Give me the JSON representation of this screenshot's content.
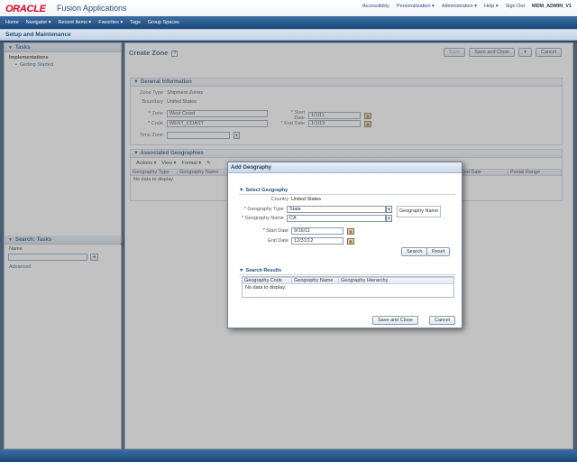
{
  "header": {
    "logo_text": "ORACLE",
    "app_name": "Fusion Applications",
    "links": [
      "Accessibility",
      "Personalization ▾",
      "Administration ▾",
      "Help ▾",
      "Sign Out"
    ],
    "user": "MDM_ADMIN_V1"
  },
  "navbar": {
    "items": [
      "Home",
      "Navigator ▾",
      "Recent Items ▾",
      "Favorites ▾",
      "Tags",
      "Group Spaces"
    ]
  },
  "titlebar": {
    "title": "Setup and Maintenance"
  },
  "tasks_panel": {
    "title": "Tasks",
    "section": "Implementations",
    "link": "Getting Started"
  },
  "search_tasks": {
    "title": "Search: Tasks",
    "name_label": "Name",
    "go_icon": "arrow-right-icon",
    "advanced": "Advanced"
  },
  "main": {
    "title": "Create Zone",
    "help_icon": "?",
    "buttons": {
      "save": "Save",
      "save_close": "Save and Close",
      "dropdown": "▾",
      "cancel": "Cancel"
    },
    "general": {
      "title": "General Information",
      "zone_type_label": "Zone Type",
      "zone_type_value": "Shipment Zones",
      "boundary_label": "Boundary",
      "boundary_value": "United States",
      "zone_label": "Zone",
      "zone_value": "West Coast",
      "code_label": "Code",
      "code_value": "WEST_COAST",
      "start_label": "Start Date",
      "start_value": "1/1/11",
      "end_label": "End Date",
      "end_value": "1/1/19",
      "tz_label": "Time Zone",
      "tz_value": ""
    },
    "assoc": {
      "title": "Associated Geographies",
      "toolbar": [
        "Actions ▾",
        "View ▾",
        "Format ▾"
      ],
      "columns": [
        "Geography Type",
        "Geography Name",
        "",
        "",
        "",
        "End Date",
        "Postal Range"
      ],
      "no_data": "No data to display."
    }
  },
  "dialog": {
    "title": "Add Geography",
    "select_section": "Select Geography",
    "country_label": "Country",
    "country_value": "United States",
    "geo_type_label": "Geography Type",
    "geo_type_value": "State",
    "geo_name_label": "Geography Name",
    "geo_name_value": "CA",
    "geo_name_badge": "Geography Name",
    "start_label": "Start Date",
    "start_value": "9/16/11",
    "end_label": "End Date",
    "end_value": "12/31/12",
    "search_btn": "Search",
    "reset_btn": "Reset",
    "results_section": "Search Results",
    "result_columns": [
      "Geography Code",
      "Geography Name",
      "Geography Hierarchy"
    ],
    "no_data": "No data to display.",
    "save_close": "Save and Close",
    "cancel": "Cancel"
  }
}
